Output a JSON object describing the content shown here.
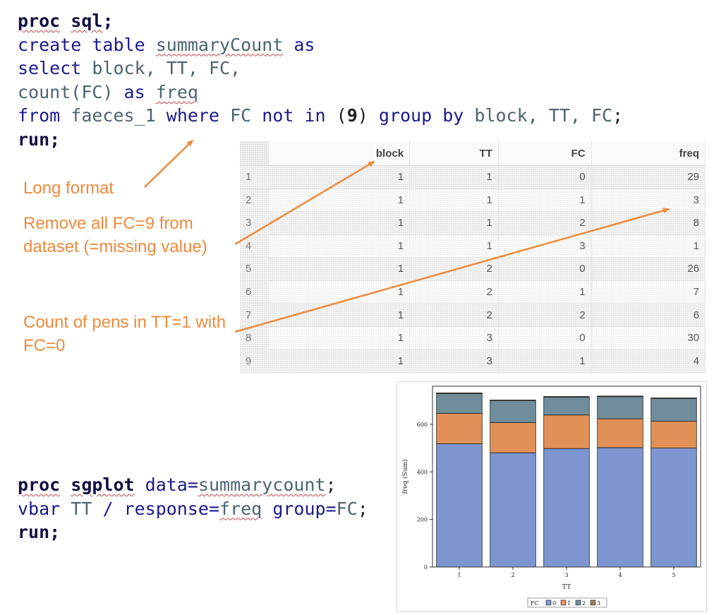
{
  "code_top": {
    "line1": [
      "proc",
      "sql",
      ";"
    ],
    "line2": [
      "create table",
      "summaryCount",
      "as"
    ],
    "line3": [
      "select",
      "block, TT, FC,"
    ],
    "line4": [
      "count(",
      "FC",
      ")",
      "as",
      "freq"
    ],
    "line5": [
      "from",
      "faeces_1",
      "where",
      "FC",
      "not in",
      "(",
      "9",
      ")",
      "group by",
      "block, TT, FC",
      ";"
    ],
    "line6": [
      "run",
      ";"
    ]
  },
  "code_bottom": {
    "line1": [
      "proc",
      "sgplot",
      "data=",
      "summarycount",
      ";"
    ],
    "line2": [
      "vbar",
      "TT",
      "/ response=",
      "freq",
      "group=",
      "FC",
      ";"
    ],
    "line3": [
      "run",
      ";"
    ]
  },
  "notes": {
    "long_format": "Long format",
    "remove_missing": "Remove all FC=9 from dataset (=missing value)",
    "count_pens": "Count of pens in TT=1 with FC=0"
  },
  "table": {
    "columns": [
      "block",
      "TT",
      "FC",
      "freq"
    ],
    "rows": [
      [
        "1",
        "1",
        "1",
        "0",
        "29"
      ],
      [
        "2",
        "1",
        "1",
        "1",
        "3"
      ],
      [
        "3",
        "1",
        "1",
        "2",
        "8"
      ],
      [
        "4",
        "1",
        "1",
        "3",
        "1"
      ],
      [
        "5",
        "1",
        "2",
        "0",
        "26"
      ],
      [
        "6",
        "1",
        "2",
        "1",
        "7"
      ],
      [
        "7",
        "1",
        "2",
        "2",
        "6"
      ],
      [
        "8",
        "1",
        "3",
        "0",
        "30"
      ],
      [
        "9",
        "1",
        "3",
        "1",
        "4"
      ]
    ]
  },
  "colors": {
    "note": "#ee8a3c",
    "fc0": "#7e96cf",
    "fc1": "#e19058",
    "fc2": "#6f8d9a",
    "fc3": "#a57c62"
  },
  "chart_data": {
    "type": "bar",
    "stacked": true,
    "categories": [
      "1",
      "2",
      "3",
      "4",
      "5"
    ],
    "series": [
      {
        "name": "0",
        "values": [
          518,
          480,
          498,
          502,
          500
        ]
      },
      {
        "name": "1",
        "values": [
          128,
          127,
          141,
          121,
          113
        ]
      },
      {
        "name": "2",
        "values": [
          83,
          92,
          75,
          93,
          95
        ]
      },
      {
        "name": "3",
        "values": [
          3,
          3,
          3,
          3,
          3
        ]
      }
    ],
    "xlabel": "TT",
    "ylabel": "freq (Sum)",
    "ylim": [
      0,
      760
    ],
    "yticks": [
      "0",
      "200",
      "400",
      "600"
    ],
    "legend_title": "FC",
    "legend_placement": "bottom"
  }
}
